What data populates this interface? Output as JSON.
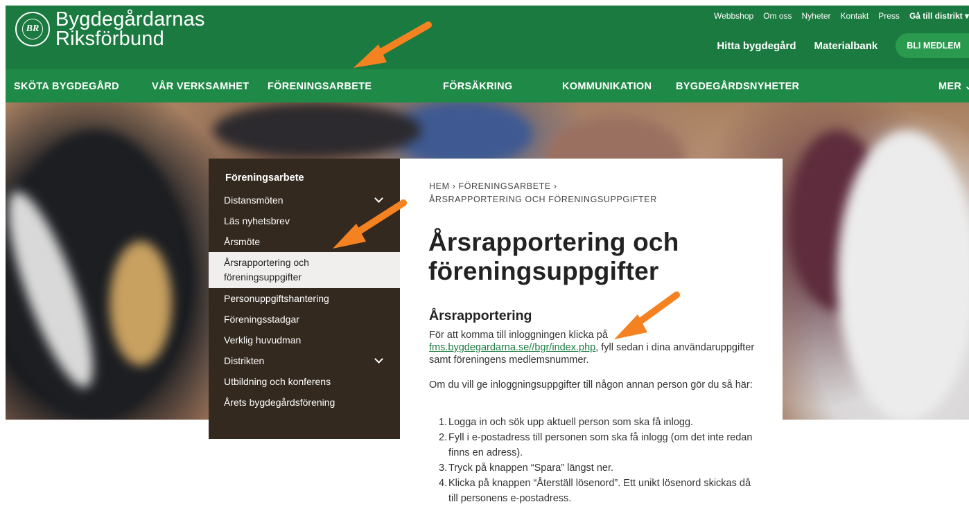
{
  "header": {
    "logo_line1": "Bygdegårdarnas",
    "logo_line2": "Riksförbund",
    "logo_seal": "BR",
    "logo_seal_text": "BYGDEGÅRDARNAS RIKSFÖRBUND",
    "top_links": [
      "Webbshop",
      "Om oss",
      "Nyheter",
      "Kontakt",
      "Press"
    ],
    "district_link": "Gå till distrikt",
    "main_links": [
      "Hitta bygdegård",
      "Materialbank"
    ],
    "join_button": "BLI MEDLEM"
  },
  "nav": {
    "items": [
      "SKÖTA BYGDEGÅRD",
      "VÅR VERKSAMHET",
      "FÖRENINGSARBETE",
      "FÖRSÄKRING",
      "KOMMUNIKATION",
      "BYGDEGÅRDSNYHETER",
      "MER"
    ]
  },
  "sidebar": {
    "title": "Föreningsarbete",
    "items": [
      {
        "label": "Distansmöten",
        "expandable": true
      },
      {
        "label": "Läs nyhetsbrev",
        "expandable": false
      },
      {
        "label": "Årsmöte",
        "expandable": false
      },
      {
        "label_line1": "Årsrapportering och",
        "label_line2": "föreningsuppgifter",
        "active": true
      },
      {
        "label": "Personuppgiftshantering",
        "expandable": false
      },
      {
        "label": "Föreningsstadgar",
        "expandable": false
      },
      {
        "label": "Verklig huvudman",
        "expandable": false
      },
      {
        "label": "Distrikten",
        "expandable": true
      },
      {
        "label": "Utbildning och konferens",
        "expandable": false
      },
      {
        "label": "Årets bygdegårdsförening",
        "expandable": false
      }
    ]
  },
  "content": {
    "breadcrumb_line1": "HEM › FÖRENINGSARBETE ›",
    "breadcrumb_line2": "ÅRSRAPPORTERING OCH FÖRENINGSUPPGIFTER",
    "title_line1": "Årsrapportering och",
    "title_line2": "föreningsuppgifter",
    "section_heading": "Årsrapportering",
    "para1_before": "För att komma till inloggningen klicka på",
    "para1_link": "fms.bygdegardarna.se//bgr/index.php",
    "para1_after": ", fyll sedan i dina användaruppgifter samt föreningens medlemsnummer.",
    "para2": "Om du vill ge inloggningsuppgifter till någon annan person gör du så här:",
    "steps": [
      "Logga in och sök upp aktuell person som ska få inlogg.",
      "Fyll i e-postadress till personen som ska få inlogg (om det inte redan finns en adress).",
      "Tryck på knappen “Spara” längst ner.",
      "Klicka på knappen “Återställ lösenord”. Ett unikt lösenord skickas då till personens e-postadress."
    ]
  },
  "colors": {
    "header_green": "#1b7a40",
    "nav_green": "#1f8a47",
    "sidebar_brown": "#33291f",
    "arrow_orange": "#f58220",
    "link_green": "#1b7a40"
  }
}
